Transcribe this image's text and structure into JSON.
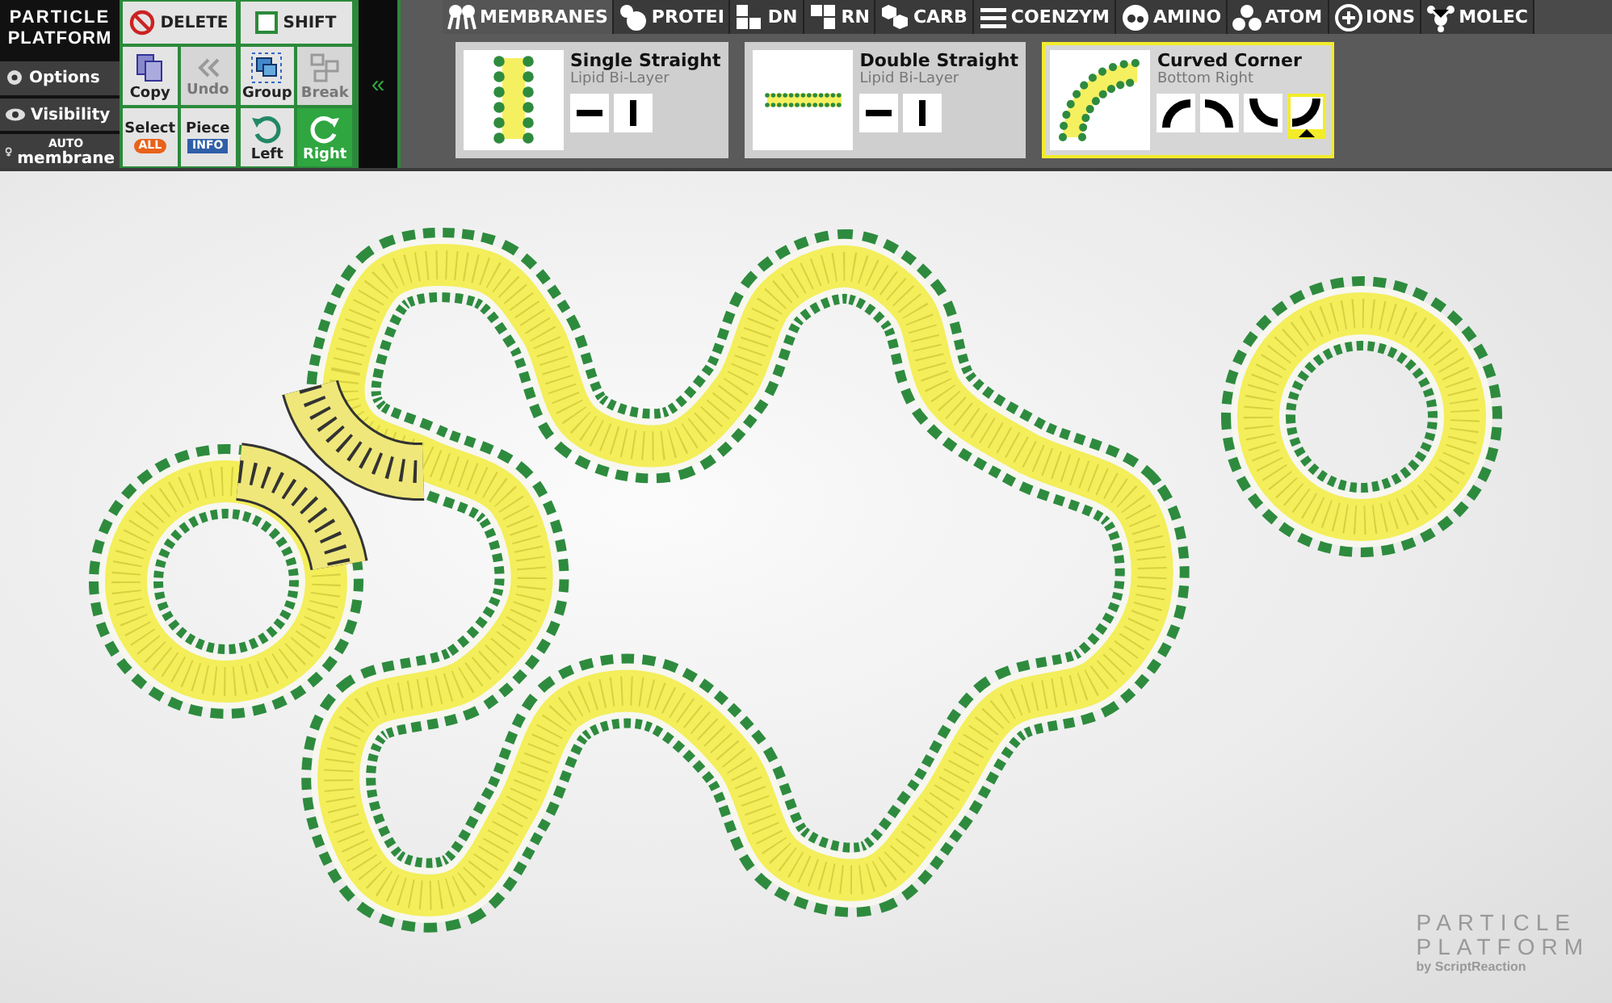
{
  "logo": {
    "line_1": "PARTICLE",
    "line_2": "PLATFORM"
  },
  "side_menu": [
    {
      "kind": "gear",
      "label": "Options"
    },
    {
      "kind": "eye",
      "label": "Visibility"
    },
    {
      "kind": "auto",
      "label": "membrane",
      "sup": "AUTO"
    }
  ],
  "delete_button": {
    "label": "DELETE"
  },
  "shift_button": {
    "label": "SHIFT",
    "checked": false
  },
  "tools": [
    {
      "kind": "copy",
      "label": "Copy",
      "disabled": false,
      "selected": false
    },
    {
      "kind": "undo",
      "label": "Undo",
      "disabled": true,
      "selected": false
    },
    {
      "kind": "group",
      "label": "Group",
      "disabled": false,
      "selected": false
    },
    {
      "kind": "break",
      "label": "Break",
      "disabled": true,
      "selected": false
    },
    {
      "kind": "select",
      "label": "Select",
      "badge": "ALL",
      "disabled": false,
      "selected": false
    },
    {
      "kind": "piece",
      "label": "Piece",
      "badge": "INFO",
      "disabled": false,
      "selected": false
    },
    {
      "kind": "left",
      "label": "Left",
      "disabled": false,
      "selected": false
    },
    {
      "kind": "right",
      "label": "Right",
      "disabled": false,
      "selected": true
    }
  ],
  "collapse_button": {
    "label": "«"
  },
  "tabs": [
    {
      "kind": "membranes",
      "label": "MEMBRANES",
      "selected": true
    },
    {
      "kind": "protein",
      "label": "PROTEI",
      "selected": false
    },
    {
      "kind": "dna",
      "label": "DN",
      "selected": false
    },
    {
      "kind": "rna",
      "label": "RN",
      "selected": false
    },
    {
      "kind": "carbs",
      "label": "CARB",
      "selected": false
    },
    {
      "kind": "coenzyme",
      "label": "COENZYM",
      "selected": false
    },
    {
      "kind": "amino",
      "label": "AMINO",
      "selected": false
    },
    {
      "kind": "atom",
      "label": "ATOM",
      "selected": false
    },
    {
      "kind": "ions",
      "label": "IONS",
      "selected": false
    },
    {
      "kind": "molec",
      "label": "MOLEC",
      "selected": false
    }
  ],
  "pieces": [
    {
      "kind": "single",
      "title": "Single Straight",
      "subtitle": "Lipid Bi-Layer",
      "selected": false,
      "options": [
        {
          "kind": "horizontal",
          "selected": false
        },
        {
          "kind": "vertical",
          "selected": false
        }
      ]
    },
    {
      "kind": "double",
      "title": "Double Straight",
      "subtitle": "Lipid Bi-Layer",
      "selected": false,
      "options": [
        {
          "kind": "horizontal",
          "selected": false
        },
        {
          "kind": "vertical",
          "selected": false
        }
      ]
    },
    {
      "kind": "curved",
      "title": "Curved Corner",
      "subtitle": "Bottom Right",
      "selected": true,
      "options": [
        {
          "kind": "top-left",
          "selected": false
        },
        {
          "kind": "top-right",
          "selected": false
        },
        {
          "kind": "bottom-left",
          "selected": false
        },
        {
          "kind": "bottom-right",
          "selected": true
        }
      ]
    }
  ],
  "brand": {
    "line_1": "PARTICLE",
    "line_2": "PLATFORM",
    "byline": "by ScriptReaction"
  }
}
